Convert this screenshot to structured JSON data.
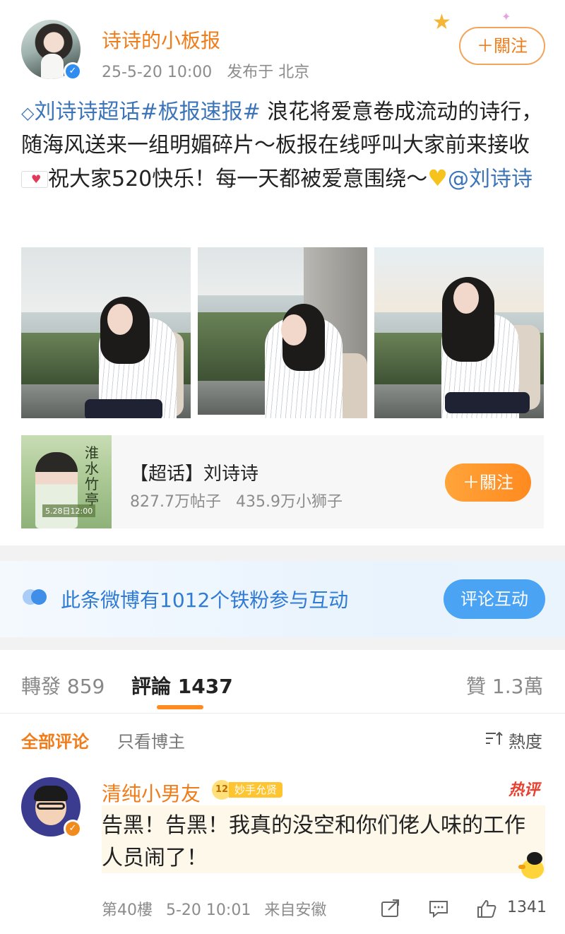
{
  "post": {
    "username": "诗诗的小板报",
    "timestamp": "25-5-20 10:00",
    "published": "发布于 北京",
    "follow_label": "＋關注",
    "text": {
      "topic1": "刘诗诗超话",
      "topic2": "#板报速报#",
      "body1": " 浪花将爱意卷成流动的诗行，随海风送来一组明媚碎片～板报在线呼叫大家前来接收",
      "body2": "祝大家520快乐！每一天都被爱意围绕～",
      "mention": "@刘诗诗"
    }
  },
  "topic_card": {
    "calligraphy": "淮水竹亭",
    "date_text": "5.28日12:00",
    "title": "【超话】刘诗诗",
    "posts": "827.7万帖子",
    "fans": "435.9万小狮子",
    "follow_label": "＋關注"
  },
  "fan_banner": {
    "text": "此条微博有1012个铁粉参与互动",
    "button": "评论互动"
  },
  "tabs": {
    "repost": "轉發 859",
    "comments_label": "評論",
    "comments_count": "1437",
    "likes": "贊 1.3萬"
  },
  "filters": {
    "all": "全部评论",
    "author_only": "只看博主",
    "sort": "熱度"
  },
  "comment": {
    "name": "清纯小男友",
    "level": "12",
    "badge": "妙手允贤",
    "hot_tag": "热评",
    "text": "告黑！告黑！我真的没空和你们佬人味的工作人员闹了！",
    "floor": "第40樓",
    "time": "5-20 10:01",
    "source": "来自安徽",
    "like_count": "1341"
  },
  "icons": {
    "verified": "verified-icon",
    "diamond": "supertopic-diamond-icon",
    "share": "share-icon",
    "comment": "comment-icon",
    "like": "thumbs-up-icon",
    "sort": "sort-icon"
  },
  "colors": {
    "accent_orange": "#f07c1a",
    "link_blue": "#3b74b8",
    "fan_blue": "#2f7bd6"
  }
}
